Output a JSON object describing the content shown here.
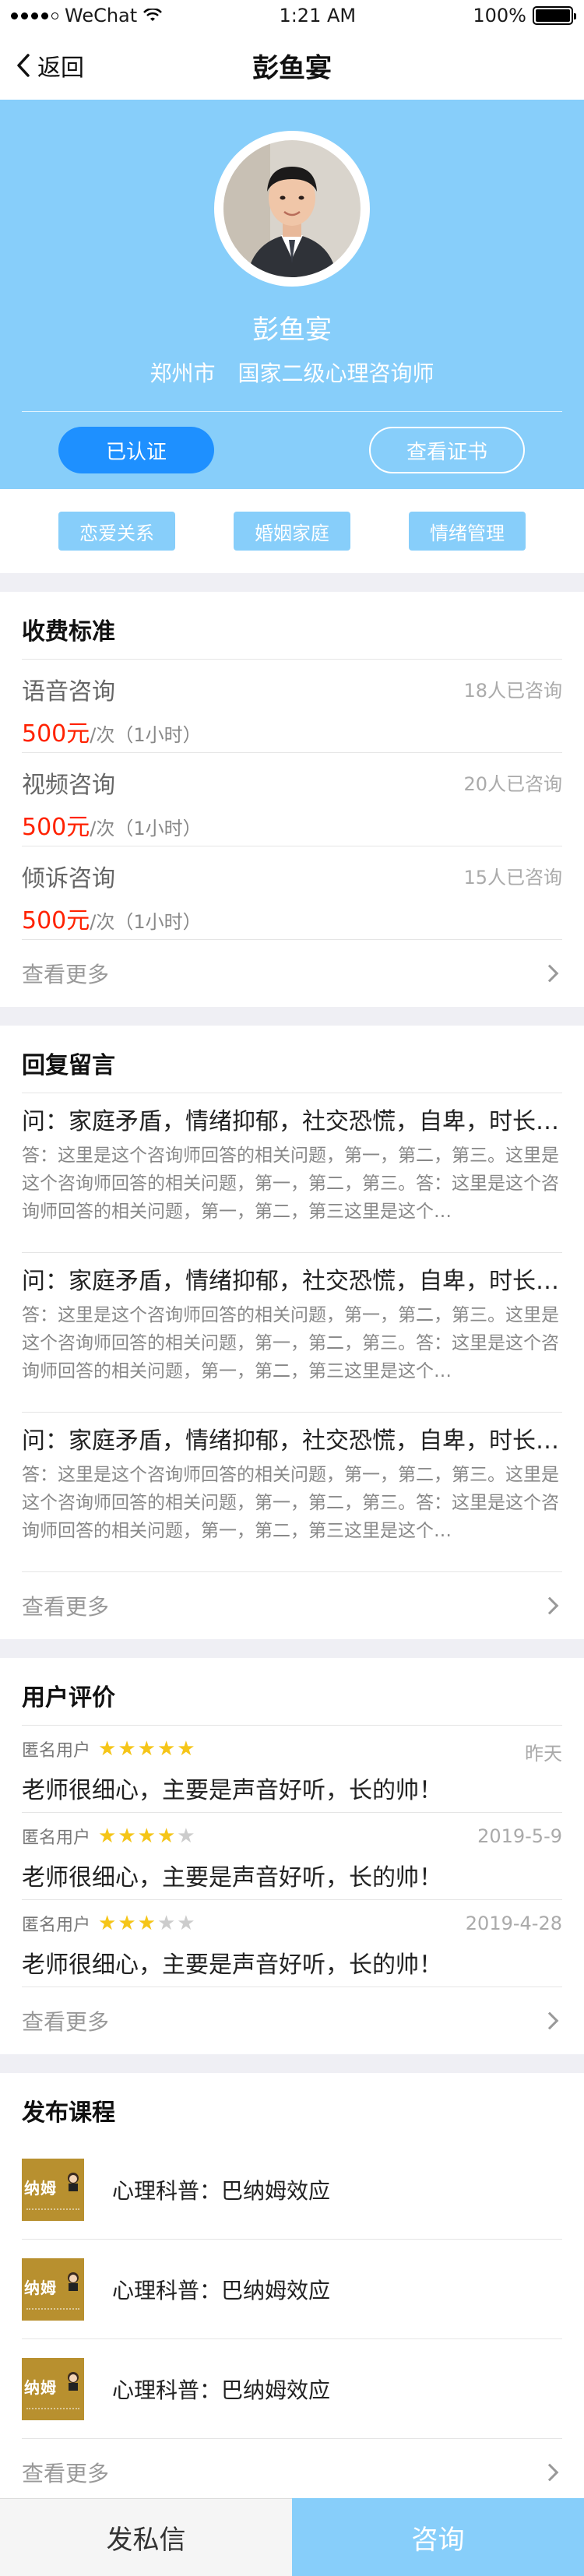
{
  "status_bar": {
    "carrier": "WeChat",
    "time": "1:21 AM",
    "battery": "100%"
  },
  "nav": {
    "back_label": "返回",
    "title": "彭鱼宴"
  },
  "profile": {
    "name": "彭鱼宴",
    "city": "郑州市",
    "title": "国家二级心理咨询师",
    "certified_label": "已认证",
    "view_cert_label": "查看证书"
  },
  "tags": [
    "恋爱关系",
    "婚姻家庭",
    "情绪管理"
  ],
  "fees": {
    "title": "收费标准",
    "items": [
      {
        "name": "语音咨询",
        "count": "18人已咨询",
        "price": "500元",
        "unit": "/次（1小时）"
      },
      {
        "name": "视频咨询",
        "count": "20人已咨询",
        "price": "500元",
        "unit": "/次（1小时）"
      },
      {
        "name": "倾诉咨询",
        "count": "15人已咨询",
        "price": "500元",
        "unit": "/次（1小时）"
      }
    ],
    "more_label": "查看更多"
  },
  "qa": {
    "title": "回复留言",
    "items": [
      {
        "question": "问：家庭矛盾，情绪抑郁，社交恐慌，自卑，时长…",
        "answer": "答：这里是这个咨询师回答的相关问题，第一，第二，第三。这里是这个咨询师回答的相关问题，第一，第二，第三。答：这里是这个咨询师回答的相关问题，第一，第二，第三这里是这个…"
      },
      {
        "question": "问：家庭矛盾，情绪抑郁，社交恐慌，自卑，时长…",
        "answer": "答：这里是这个咨询师回答的相关问题，第一，第二，第三。这里是这个咨询师回答的相关问题，第一，第二，第三。答：这里是这个咨询师回答的相关问题，第一，第二，第三这里是这个…"
      },
      {
        "question": "问：家庭矛盾，情绪抑郁，社交恐慌，自卑，时长…",
        "answer": "答：这里是这个咨询师回答的相关问题，第一，第二，第三。这里是这个咨询师回答的相关问题，第一，第二，第三。答：这里是这个咨询师回答的相关问题，第一，第二，第三这里是这个…"
      }
    ],
    "more_label": "查看更多"
  },
  "reviews": {
    "title": "用户评价",
    "items": [
      {
        "user": "匿名用户",
        "rating": 5,
        "date": "昨天",
        "text": "老师很细心，主要是声音好听，长的帅！"
      },
      {
        "user": "匿名用户",
        "rating": 4,
        "date": "2019-5-9",
        "text": "老师很细心，主要是声音好听，长的帅！"
      },
      {
        "user": "匿名用户",
        "rating": 3,
        "date": "2019-4-28",
        "text": "老师很细心，主要是声音好听，长的帅！"
      }
    ],
    "more_label": "查看更多"
  },
  "courses": {
    "title": "发布课程",
    "items": [
      {
        "thumb_text": "纳姆",
        "title": "心理科普：巴纳姆效应"
      },
      {
        "thumb_text": "纳姆",
        "title": "心理科普：巴纳姆效应"
      },
      {
        "thumb_text": "纳姆",
        "title": "心理科普：巴纳姆效应"
      }
    ],
    "more_label": "查看更多"
  },
  "bottom": {
    "message_label": "发私信",
    "consult_label": "咨询"
  },
  "colors": {
    "primary": "#87CEFA",
    "accent_blue": "#1E90FF",
    "price_red": "#FF2200",
    "star": "#F5C518"
  }
}
